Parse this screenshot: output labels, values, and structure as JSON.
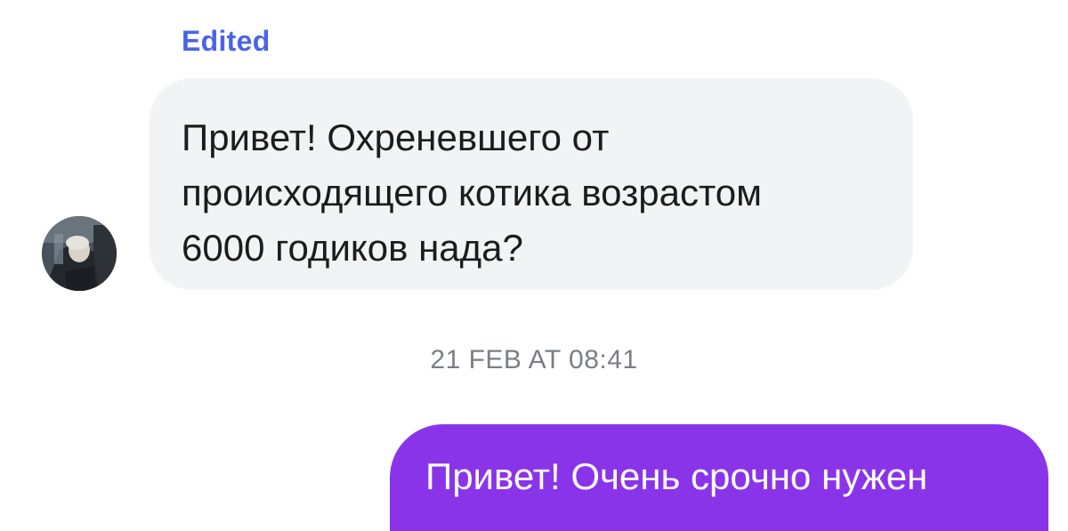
{
  "colors": {
    "edited_label": "#4a63e8",
    "incoming_bubble": "#f2f3f5",
    "outgoing_bubble": "#8a34ea",
    "timestamp_text": "#7a7f86"
  },
  "incoming_message": {
    "status": "Edited",
    "text": "Привет! Охреневшего от\nпроисходящего котика возрастом\n6000 годиков нада?",
    "avatar_icon": "user-avatar-photo"
  },
  "separator": {
    "timestamp": "21 FEB AT 08:41"
  },
  "outgoing_message": {
    "text": "Привет! Очень срочно нужен"
  }
}
